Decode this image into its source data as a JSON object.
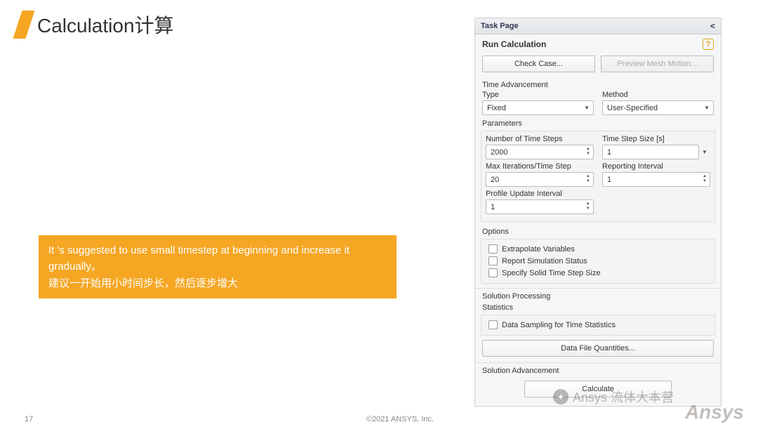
{
  "slide": {
    "title": "Calculation计算",
    "tip_line1": "It 's suggested to use small timestep at beginning and increase it gradually。",
    "tip_line2": "建议一开始用小时间步长，然后逐步增大",
    "page_number": "17",
    "copyright": "©2021 ANSYS, Inc.",
    "brand": "Ansys",
    "watermark": "Ansys 流体大本营"
  },
  "taskpage": {
    "header": "Task Page",
    "title": "Run Calculation",
    "check_case": "Check Case...",
    "preview_mesh": "Preview Mesh Motion...",
    "time_advancement": {
      "label": "Time Advancement",
      "type_label": "Type",
      "type_value": "Fixed",
      "method_label": "Method",
      "method_value": "User-Specified"
    },
    "parameters": {
      "label": "Parameters",
      "num_steps_label": "Number of Time Steps",
      "num_steps_value": "2000",
      "step_size_label": "Time Step Size [s]",
      "step_size_value": "1",
      "max_iter_label": "Max Iterations/Time Step",
      "max_iter_value": "20",
      "report_int_label": "Reporting Interval",
      "report_int_value": "1",
      "profile_label": "Profile Update Interval",
      "profile_value": "1"
    },
    "options": {
      "label": "Options",
      "extrapolate": "Extrapolate Variables",
      "report_status": "Report Simulation Status",
      "solid_step": "Specify Solid Time Step Size"
    },
    "solution_processing": {
      "label": "Solution Processing",
      "stats_label": "Statistics",
      "data_sampling": "Data Sampling for Time Statistics",
      "data_file_btn": "Data File Quantities..."
    },
    "solution_advancement": {
      "label": "Solution Advancement",
      "calculate_btn": "Calculate"
    }
  }
}
